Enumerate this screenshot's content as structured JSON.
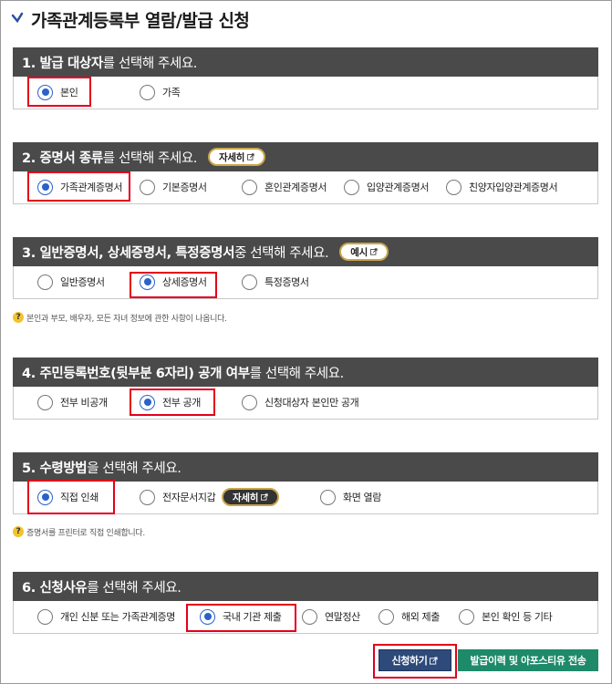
{
  "page_title": "가족관계등록부 열람/발급 신청",
  "sections": [
    {
      "head_bold": "1. 발급 대상자",
      "head_rest": "를 선택해 주세요.",
      "options": [
        {
          "label": "본인",
          "selected": true
        },
        {
          "label": "가족",
          "selected": false
        }
      ]
    },
    {
      "head_bold": "2. 증명서 종류",
      "head_rest": "를 선택해 주세요.",
      "pill": "자세히",
      "options": [
        {
          "label": "가족관계증명서",
          "selected": true
        },
        {
          "label": "기본증명서",
          "selected": false
        },
        {
          "label": "혼인관계증명서",
          "selected": false
        },
        {
          "label": "입양관계증명서",
          "selected": false
        },
        {
          "label": "친양자입양관계증명서",
          "selected": false
        }
      ]
    },
    {
      "head_bold": "3. 일반증명서, 상세증명서, 특정증명서",
      "head_rest": " 중 선택해 주세요.",
      "pill": "예시",
      "options": [
        {
          "label": "일반증명서",
          "selected": false
        },
        {
          "label": "상세증명서",
          "selected": true
        },
        {
          "label": "특정증명서",
          "selected": false
        }
      ],
      "note": "본인과 부모, 배우자, 모든 자녀 정보에 관한 사항이 나옵니다."
    },
    {
      "head_bold": "4. 주민등록번호(뒷부분 6자리) 공개 여부",
      "head_rest": "를 선택해 주세요.",
      "options": [
        {
          "label": "전부 비공개",
          "selected": false
        },
        {
          "label": "전부 공개",
          "selected": true
        },
        {
          "label": "신청대상자 본인만 공개",
          "selected": false
        }
      ]
    },
    {
      "head_bold": "5. 수령방법",
      "head_rest": "을 선택해 주세요.",
      "options": [
        {
          "label": "직접 인쇄",
          "selected": true
        },
        {
          "label": "전자문서지갑",
          "selected": false
        },
        {
          "label": "화면 열람",
          "selected": false
        }
      ],
      "inline_pill": "자세히",
      "note": "증명서를 프린터로 직접 인쇄합니다."
    },
    {
      "head_bold": "6. 신청사유",
      "head_rest": "를 선택해 주세요.",
      "options": [
        {
          "label": "개인 신분 또는 가족관계증명",
          "selected": false
        },
        {
          "label": "국내 기관 제출",
          "selected": true
        },
        {
          "label": "연말정산",
          "selected": false
        },
        {
          "label": "해외 제출",
          "selected": false
        },
        {
          "label": "본인 확인 등 기타",
          "selected": false
        }
      ]
    }
  ],
  "buttons": {
    "apply": "신청하기",
    "history": "발급이력 및 아포스티유 전송"
  },
  "colors": {
    "header_bg": "#4a4a4a",
    "radio_selected": "#2a62c9",
    "highlight": "#e3001b",
    "pill_border": "#c9a64a",
    "apply_bg": "#2e4a7a",
    "history_bg": "#1e8a6a"
  },
  "icons": {
    "title_mark": "check-mark-icon",
    "external_link": "external-link-icon",
    "help": "question-mark-icon"
  }
}
